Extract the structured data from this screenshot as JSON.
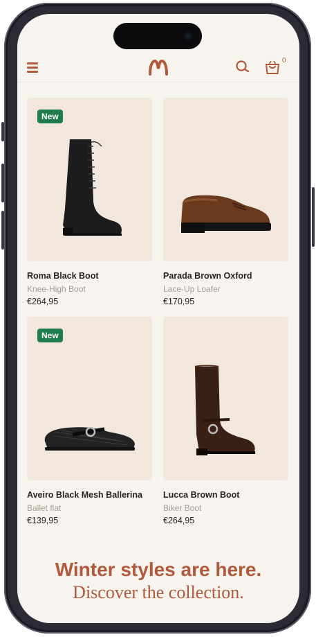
{
  "header": {
    "menu_icon": "hamburger-menu-icon",
    "logo_icon": "brand-logo-icon",
    "search_icon": "search-icon",
    "bag_icon": "shopping-bag-icon",
    "cart_count": "0"
  },
  "products": [
    {
      "name": "Roma Black Boot",
      "type": "Knee-High Boot",
      "price": "€264,95",
      "badge": "New"
    },
    {
      "name": "Parada Brown Oxford",
      "type": "Lace-Up Loafer",
      "price": "€170,95",
      "badge": ""
    },
    {
      "name": "Aveiro Black Mesh Ballerina",
      "type": "Ballet flat",
      "price": "€139,95",
      "badge": "New"
    },
    {
      "name": "Lucca Brown Boot",
      "type": "Biker Boot",
      "price": "€264,95",
      "badge": ""
    }
  ],
  "promo": {
    "line1": "Winter styles are here.",
    "line2": "Discover the collection."
  },
  "colors": {
    "accent": "#b1593a",
    "badge": "#1f7a4c",
    "card_bg": "#f1e7dd",
    "page_bg": "#f7f3ee"
  }
}
